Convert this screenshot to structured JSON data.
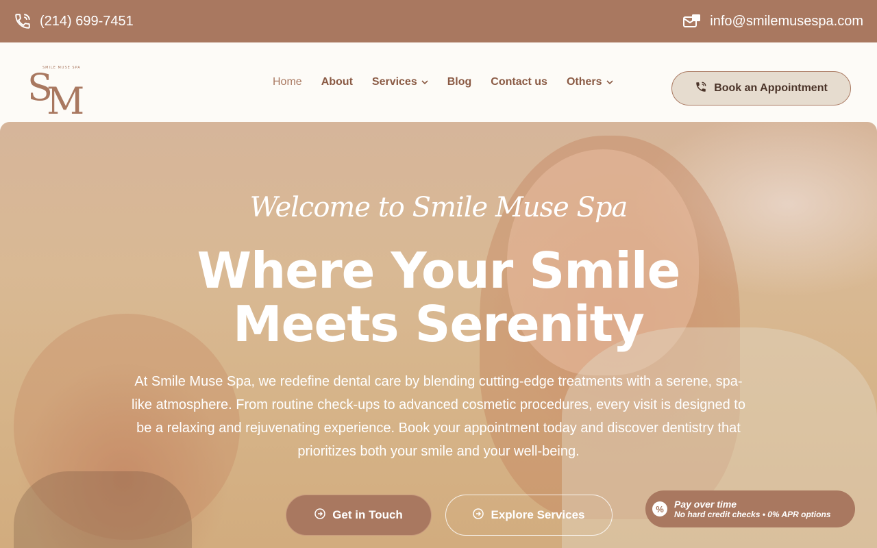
{
  "topbar": {
    "phone_icon": "phone-icon",
    "phone": "(214) 699-7451",
    "email_icon": "mail-icon",
    "email": "info@smilemusespa.com"
  },
  "header": {
    "logo": {
      "monogram_left": "S",
      "monogram_right": "M",
      "tag": "SMILE MUSE SPA"
    },
    "nav": [
      {
        "label": "Home",
        "dropdown": false,
        "active": true
      },
      {
        "label": "About",
        "dropdown": false
      },
      {
        "label": "Services",
        "dropdown": true
      },
      {
        "label": "Blog",
        "dropdown": false
      },
      {
        "label": "Contact us",
        "dropdown": false
      },
      {
        "label": "Others",
        "dropdown": true
      }
    ],
    "book_button": "Book an Appointment",
    "book_icon": "phone-icon"
  },
  "hero": {
    "welcome": "Welcome to Smile Muse Spa",
    "headline": "Where Your Smile Meets Serenity",
    "intro": "At Smile Muse Spa, we redefine dental care by blending cutting-edge treatments with a serene, spa-like atmosphere. From routine check-ups to advanced cosmetic procedures, every visit is designed to be a relaxing and rejuvenating experience. Book your appointment today and discover dentistry that prioritizes both your smile and your well-being.",
    "cta_primary": "Get in Touch",
    "cta_secondary": "Explore Services",
    "cta_icon": "arrow-circle-right-icon"
  },
  "pay_badge": {
    "icon": "percent-icon",
    "title": "Pay over time",
    "subtitle": "No hard credit checks • 0% APR options"
  },
  "colors": {
    "brand": "#a97860",
    "header_bg": "#fdfbf7",
    "button_bg": "#e6dccf"
  }
}
